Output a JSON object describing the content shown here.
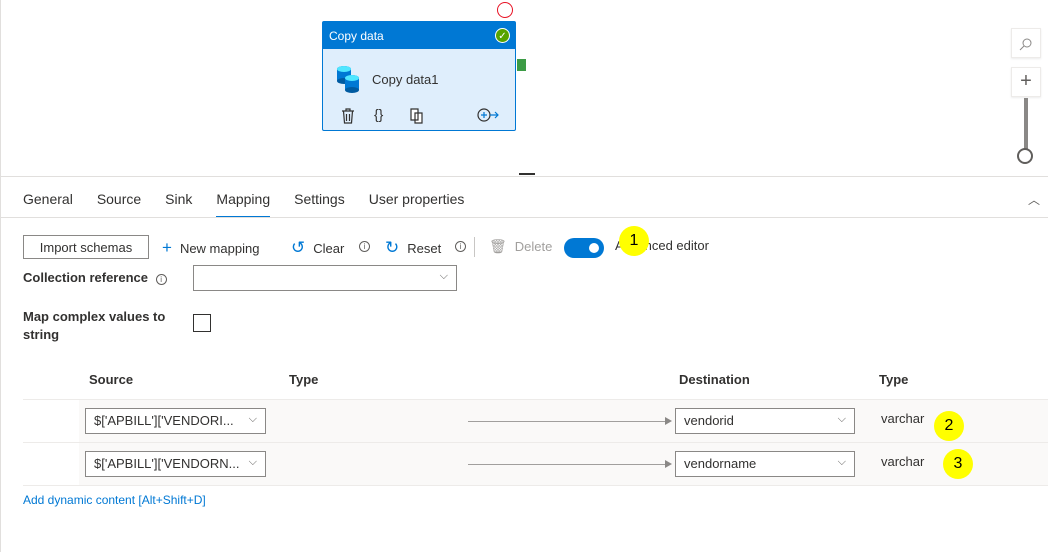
{
  "canvas": {
    "activity_type": "Copy data",
    "activity_name": "Copy data1",
    "zoom_controls": {
      "search_icon": "search-icon",
      "zoom_in_icon": "plus-icon"
    }
  },
  "tabs": [
    {
      "label": "General"
    },
    {
      "label": "Source"
    },
    {
      "label": "Sink"
    },
    {
      "label": "Mapping",
      "active": true
    },
    {
      "label": "Settings"
    },
    {
      "label": "User properties"
    }
  ],
  "toolbar": {
    "import_schemas": "Import schemas",
    "new_mapping": "New mapping",
    "clear": "Clear",
    "reset": "Reset",
    "delete": "Delete",
    "advanced_editor": "Advanced editor",
    "advanced_editor_on": true
  },
  "form": {
    "collection_reference_label": "Collection reference",
    "collection_reference_value": "",
    "map_complex_label_line1": "Map complex values to",
    "map_complex_label_line2": "string",
    "map_complex_checked": false
  },
  "mapping": {
    "headers": {
      "source": "Source",
      "source_type": "Type",
      "destination": "Destination",
      "dest_type": "Type"
    },
    "rows": [
      {
        "source": "$['APBILL']['VENDORI...",
        "destination": "vendorid",
        "type": "varchar"
      },
      {
        "source": "$['APBILL']['VENDORN...",
        "destination": "vendorname",
        "type": "varchar"
      }
    ],
    "dynamic_link": "Add dynamic content [Alt+Shift+D]"
  },
  "annotations": [
    "1",
    "2",
    "3"
  ],
  "colors": {
    "accent": "#0078d4",
    "success": "#57a300",
    "highlight": "#ffff00"
  }
}
